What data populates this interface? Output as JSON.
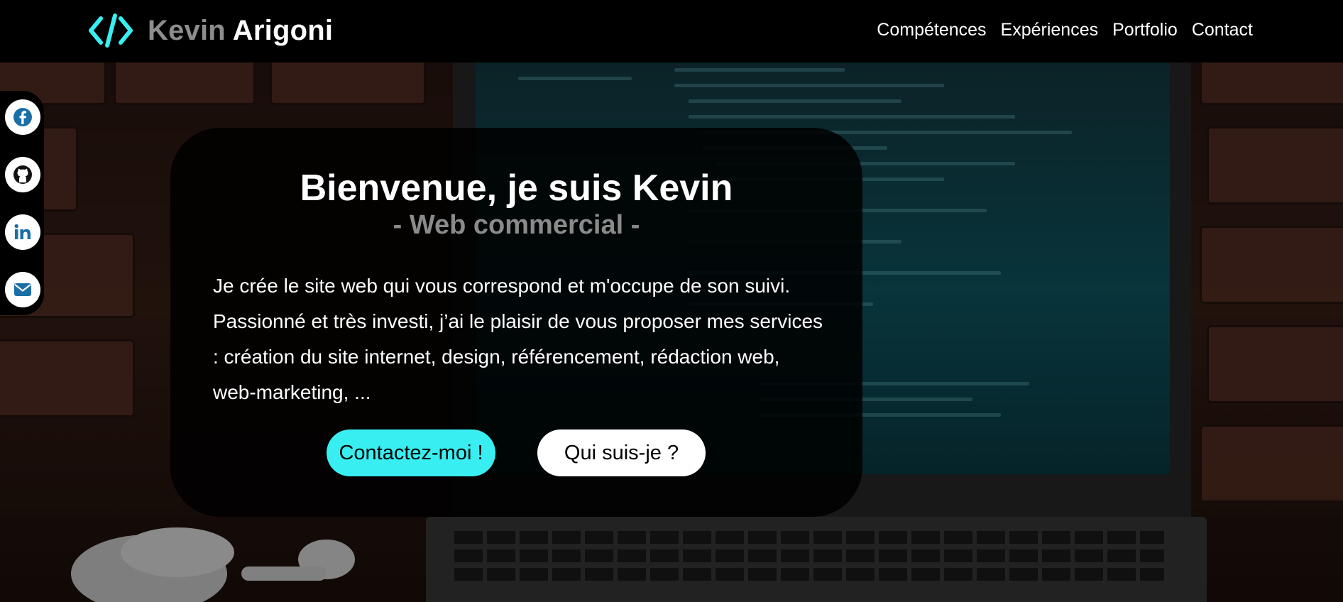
{
  "header": {
    "logo_first": "Kevin",
    "logo_last": "Arigoni",
    "logo_icon": "code-brackets-icon",
    "nav": [
      {
        "label": "Compétences"
      },
      {
        "label": "Expériences"
      },
      {
        "label": "Portfolio"
      },
      {
        "label": "Contact"
      }
    ]
  },
  "social": [
    {
      "icon": "facebook-icon"
    },
    {
      "icon": "github-icon"
    },
    {
      "icon": "linkedin-icon"
    },
    {
      "icon": "email-icon"
    }
  ],
  "hero": {
    "title": "Bienvenue, je suis Kevin",
    "subtitle": "- Web commercial -",
    "description": "Je crée le site web qui vous correspond et m'occupe de son suivi. Passionné et très investi, j’ai le plaisir de vous proposer mes services : création du site internet, design, référencement, rédaction web, web-marketing, ...",
    "primary_button": "Contactez-moi !",
    "secondary_button": "Qui suis-je ?"
  },
  "colors": {
    "accent": "#38eef0",
    "header_bg": "#000000",
    "logo_first": "#8d8d8d",
    "subtitle": "#8a8a8a",
    "social_icon": "#1b6fa8"
  }
}
